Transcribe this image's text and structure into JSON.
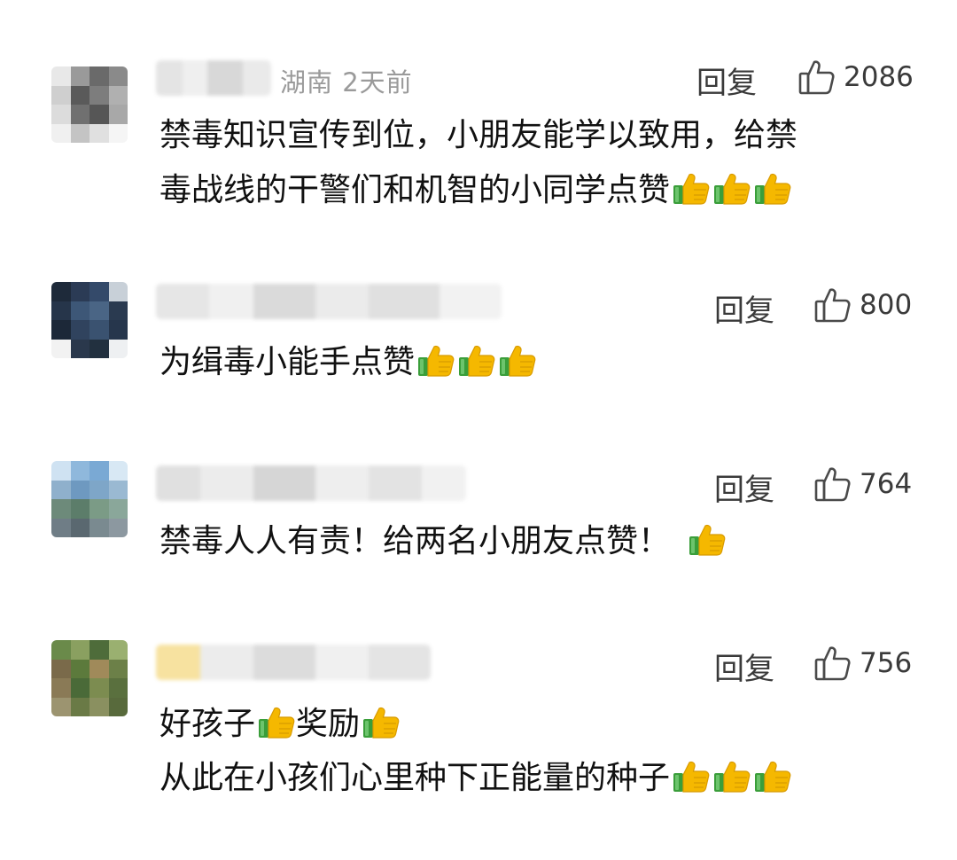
{
  "comments": [
    {
      "meta": "湖南  2天前",
      "reply": "回复",
      "likes": "2086",
      "lines": [
        "禁毒知识宣传到位，小朋友能学以致用，给禁",
        "毒战线的干警们和机智的小同学点赞"
      ],
      "line_thumbs": [
        0,
        3
      ],
      "avatar_colors": [
        "#e8e8e8",
        "#9a9a9a",
        "#6a6a6a",
        "#8a8a8a",
        "#cfcfcf",
        "#5a5a5a",
        "#7d7d7d",
        "#b0b0b0",
        "#dcdcdc",
        "#707070",
        "#565656",
        "#a8a8a8",
        "#f0f0f0",
        "#c4c4c4",
        "#e0e0e0",
        "#f5f5f5"
      ]
    },
    {
      "meta": "",
      "reply": "回复",
      "likes": "800",
      "lines": [
        "为缉毒小能手点赞"
      ],
      "line_thumbs": [
        3
      ],
      "avatar_colors": [
        "#1e2a3a",
        "#2b3b55",
        "#344a6a",
        "#c8d0d8",
        "#26354a",
        "#3d5777",
        "#4a6585",
        "#2a3a50",
        "#1c2838",
        "#30435e",
        "#3a5270",
        "#26364c",
        "#f2f2f2",
        "#2a384c",
        "#22303f",
        "#eef0f2"
      ]
    },
    {
      "meta": "",
      "reply": "回复",
      "likes": "764",
      "lines": [
        "禁毒人人有责！给两名小朋友点赞！"
      ],
      "line_thumbs": [
        1
      ],
      "avatar_colors": [
        "#cfe2f2",
        "#8fb8dc",
        "#7aa9d4",
        "#d8e8f4",
        "#8fb0cc",
        "#6e99c0",
        "#7ea6c8",
        "#9ab9d2",
        "#6d8a7a",
        "#5c7d6a",
        "#7b9b86",
        "#8aa79a",
        "#6f7d86",
        "#5a6870",
        "#7a8a90",
        "#8c98a0"
      ]
    },
    {
      "meta": "",
      "reply": "回复",
      "likes": "756",
      "lines": [
        "好孩子",
        "奖励",
        "从此在小孩们心里种下正能量的种子"
      ],
      "line_thumbs": [
        1,
        1,
        3
      ],
      "avatar_colors": [
        "#6a8a4a",
        "#8aa060",
        "#4e6c3a",
        "#9ab070",
        "#7a6a4a",
        "#5c7a3c",
        "#a08a5a",
        "#6c8048",
        "#8a7a56",
        "#4a6a38",
        "#7c8c50",
        "#5a703e",
        "#9c9470",
        "#6a7a46",
        "#8a9060",
        "#586a3c"
      ]
    }
  ],
  "colors": {
    "meta_gray": "#9a9a9a",
    "text_dark": "#111111",
    "thumb_yellow": "#f5b800",
    "thumb_green": "#3a9e3a"
  },
  "icons": {
    "like": "thumbs-up-outline-icon",
    "emoji": "thumbs-up-emoji-icon"
  }
}
